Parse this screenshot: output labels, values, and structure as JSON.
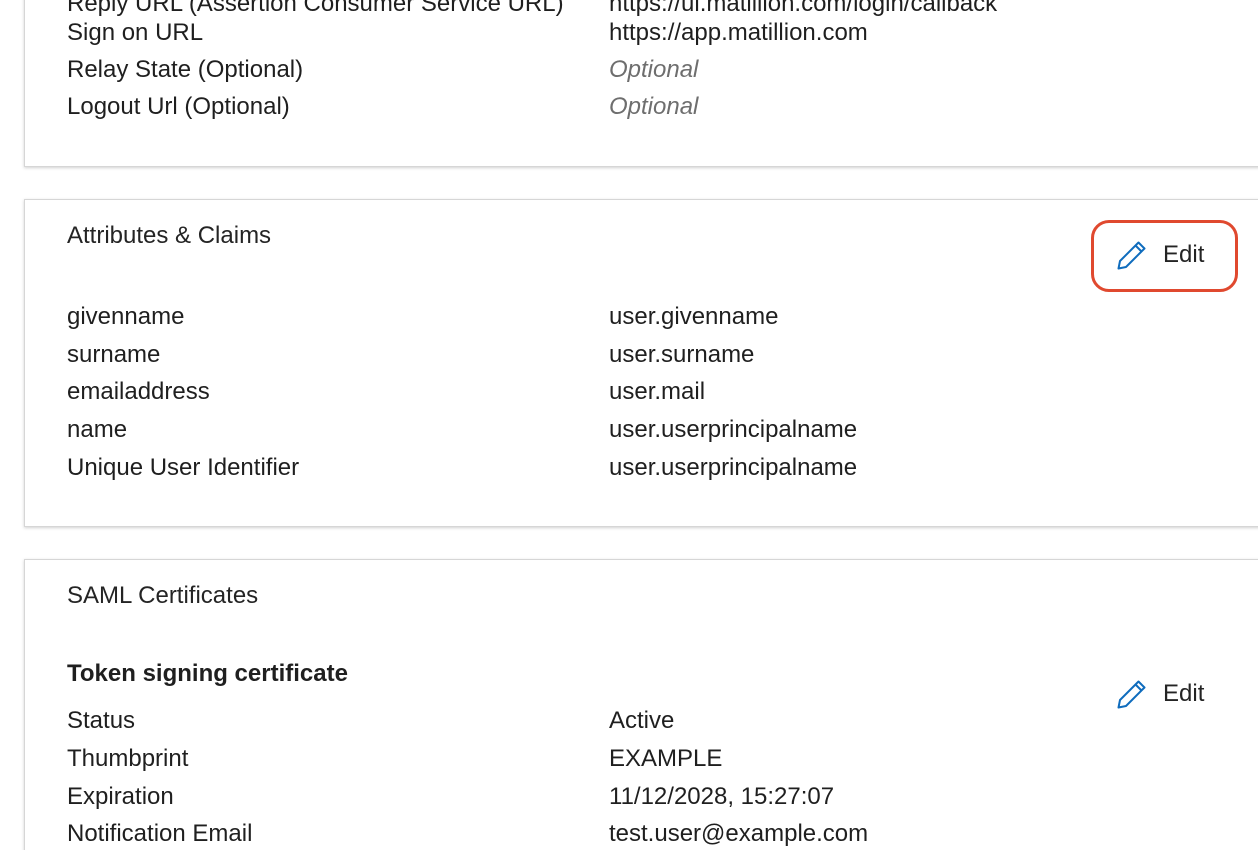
{
  "basic_saml_config": {
    "rows": [
      {
        "label": "Reply URL (Assertion Consumer Service URL)",
        "value": "https://ui.matillion.com/login/callback",
        "placeholder": false
      },
      {
        "label": "Sign on URL",
        "value": "https://app.matillion.com",
        "placeholder": false
      },
      {
        "label": "Relay State (Optional)",
        "value": "Optional",
        "placeholder": true
      },
      {
        "label": "Logout Url (Optional)",
        "value": "Optional",
        "placeholder": true
      }
    ]
  },
  "attributes_claims": {
    "title": "Attributes & Claims",
    "edit_label": "Edit",
    "highlight_color": "#e0492f",
    "rows": [
      {
        "label": "givenname",
        "value": "user.givenname"
      },
      {
        "label": "surname",
        "value": "user.surname"
      },
      {
        "label": "emailaddress",
        "value": "user.mail"
      },
      {
        "label": "name",
        "value": "user.userprincipalname"
      },
      {
        "label": "Unique User Identifier",
        "value": "user.userprincipalname"
      }
    ]
  },
  "saml_certificates": {
    "title": "SAML Certificates",
    "subheading": "Token signing certificate",
    "edit_label": "Edit",
    "rows": [
      {
        "label": "Status",
        "value": "Active"
      },
      {
        "label": "Thumbprint",
        "value": "EXAMPLE"
      },
      {
        "label": "Expiration",
        "value": "11/12/2028, 15:27:07"
      },
      {
        "label": "Notification Email",
        "value": "test.user@example.com"
      }
    ]
  },
  "icons": {
    "edit": "pencil-icon",
    "accent_color": "#0f6cbd"
  }
}
